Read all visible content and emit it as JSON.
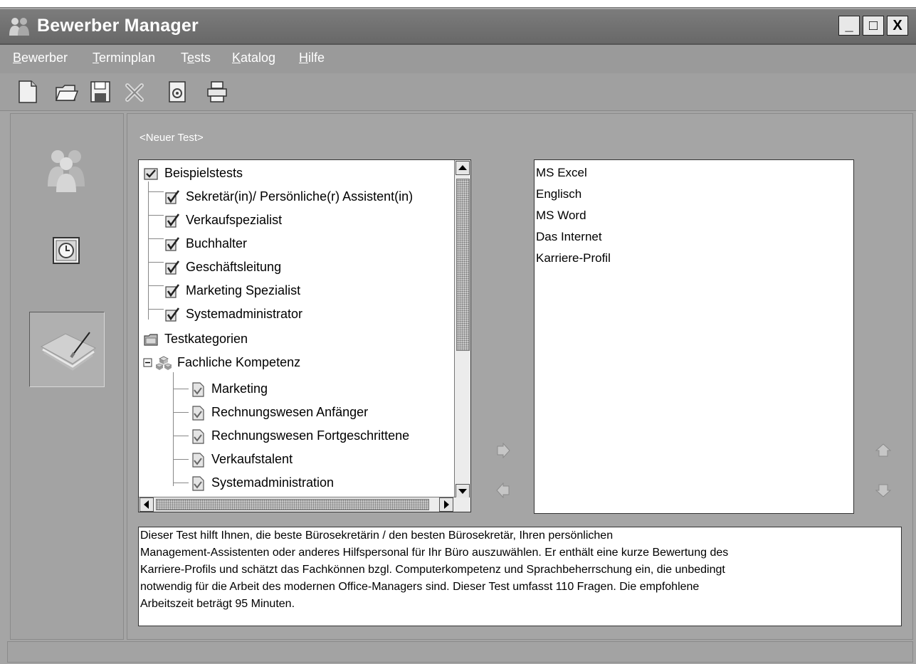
{
  "window": {
    "title": "Bewerber Manager",
    "minimize": "_",
    "maximize": "□",
    "close": "X"
  },
  "menu": [
    {
      "first": "B",
      "rest": "ewerber"
    },
    {
      "first": "T",
      "rest": "erminplan"
    },
    {
      "first": "T",
      "rest": "ests",
      "prefix": "",
      "display": "Tests"
    },
    {
      "first": "K",
      "rest": "atalog"
    },
    {
      "first": "H",
      "rest": "ilfe"
    }
  ],
  "menu_labels": {
    "m0a": "B",
    "m0b": "ewerber",
    "m1a": "T",
    "m1b": "erminplan",
    "m2a": "T",
    "m2b": "e",
    "m2c": "s",
    "m2d": "ts",
    "m3a": "K",
    "m3b": "atalog",
    "m4a": "H",
    "m4b": "ilfe"
  },
  "toolbar": [
    "new-file-icon",
    "open-folder-icon",
    "save-icon",
    "delete-icon",
    "properties-icon",
    "print-icon"
  ],
  "nav": [
    "applicants-icon",
    "schedule-icon",
    "tests-icon"
  ],
  "test_name": "<Neuer Test>",
  "tree": {
    "sample_root": "Beispielstests",
    "samples": [
      "Sekretär(in)/ Persönliche(r) Assistent(in)",
      "Verkaufspezialist",
      "Buchhalter",
      "Geschäftsleitung",
      "Marketing Spezialist",
      "Systemadministrator"
    ],
    "categories_root": "Testkategorien",
    "category": "Fachliche Kompetenz",
    "category_items": [
      "Marketing",
      "Rechnungswesen Anfänger",
      "Rechnungswesen Fortgeschrittene",
      "Verkaufstalent",
      "Systemadministration"
    ]
  },
  "selected_tests": [
    "MS Excel",
    "Englisch",
    "MS Word",
    "Das Internet",
    "Karriere-Profil"
  ],
  "description": {
    "line1": "Dieser Test hilft Ihnen, die beste Bürosekretärin / den besten Bürosekretär, Ihren persönlichen",
    "line2": "Management-Assistenten oder anderes Hilfspersonal für Ihr Büro auszuwählen. Er enthält eine kurze Bewertung des",
    "line3": "Karriere-Profils und schätzt das Fachkönnen bzgl. Computerkompetenz und Sprachbeherrschung ein, die unbedingt",
    "line4": "notwendig für die Arbeit des modernen Office-Managers sind. Dieser Test umfasst 110 Fragen. Die empfohlene",
    "line5": "Arbeitszeit beträgt 95 Minuten."
  },
  "status": ""
}
